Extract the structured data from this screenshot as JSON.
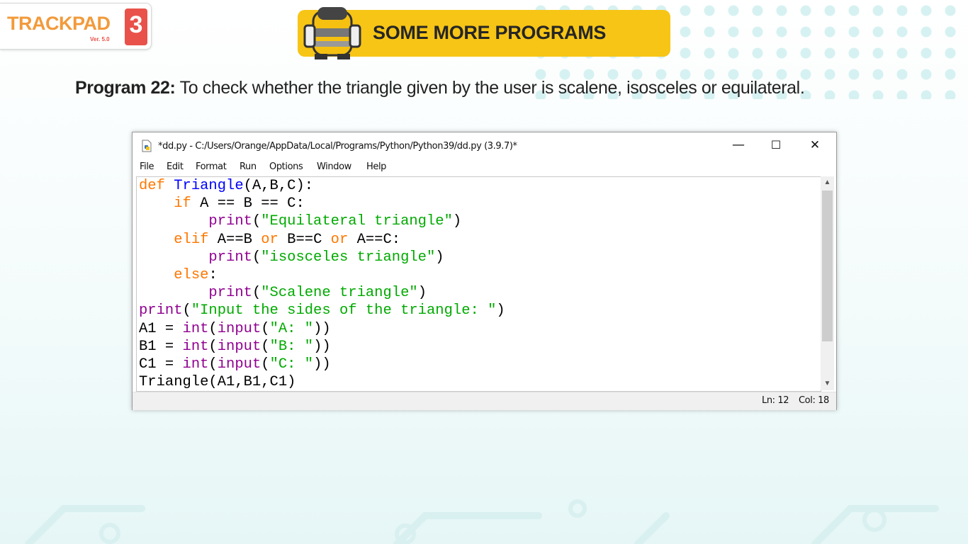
{
  "logo": {
    "text": "TRACKPAD",
    "badge": "3",
    "version": "Ver. 5.0"
  },
  "banner": {
    "title": "SOME MORE PROGRAMS"
  },
  "program": {
    "label": "Program 22:",
    "description": "To check whether the triangle given by the user is scalene, isosceles or equilateral."
  },
  "window": {
    "title": "*dd.py - C:/Users/Orange/AppData/Local/Programs/Python/Python39/dd.py (3.9.7)*",
    "controls": {
      "minimize": "—",
      "maximize": "☐",
      "close": "✕"
    },
    "menu": [
      "File",
      "Edit",
      "Format",
      "Run",
      "Options",
      "Window",
      "Help"
    ],
    "code_lines": [
      "def Triangle(A,B,C):",
      "    if A == B == C:",
      "        print(\"Equilateral triangle\")",
      "    elif A==B or B==C or A==C:",
      "        print(\"isosceles triangle\")",
      "    else:",
      "        print(\"Scalene triangle\")",
      "print(\"Input the sides of the triangle: \")",
      "A1 = int(input(\"A: \"))",
      "B1 = int(input(\"B: \"))",
      "C1 = int(input(\"C: \"))",
      "Triangle(A1,B1,C1)"
    ],
    "status": {
      "line": "Ln: 12",
      "col": "Col: 18"
    }
  },
  "colors": {
    "keyword": "#ff7700",
    "function_def": "#0000ff",
    "builtin": "#900090",
    "string": "#00aa00",
    "banner": "#f7c515",
    "logo_orange": "#f29a3b",
    "logo_red": "#e8524a"
  },
  "icons": [
    "python-file-icon",
    "robot-mascot-icon"
  ]
}
